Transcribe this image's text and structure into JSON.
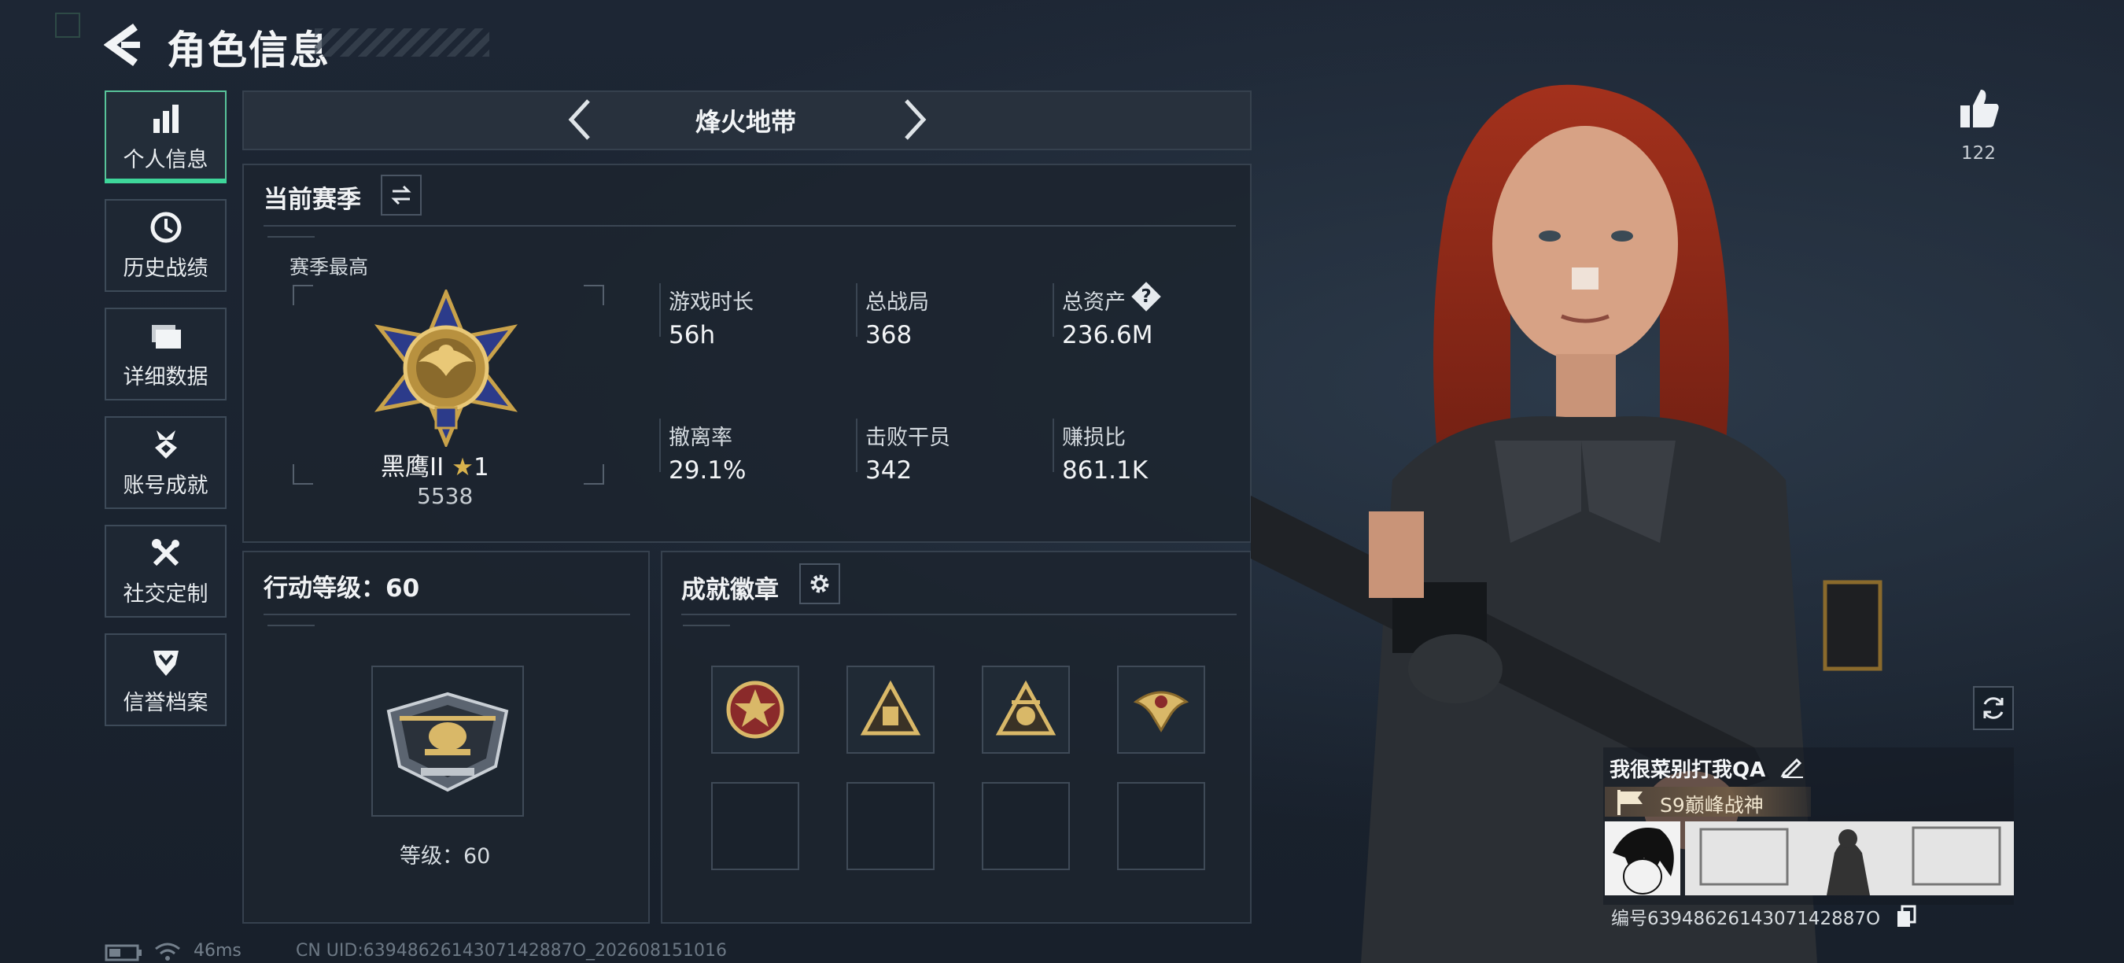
{
  "header": {
    "title": "角色信息"
  },
  "nav": {
    "items": [
      {
        "label": "个人信息",
        "icon": "bar-chart-icon",
        "active": true
      },
      {
        "label": "历史战绩",
        "icon": "clock-icon",
        "active": false
      },
      {
        "label": "详细数据",
        "icon": "folder-icon",
        "active": false
      },
      {
        "label": "账号成就",
        "icon": "medal-icon",
        "active": false
      },
      {
        "label": "社交定制",
        "icon": "wrench-icon",
        "active": false
      },
      {
        "label": "信誉档案",
        "icon": "shield-icon",
        "active": false
      }
    ]
  },
  "mode": {
    "title": "烽火地带"
  },
  "season": {
    "title": "当前赛季",
    "highest_label": "赛季最高",
    "rank_name": "黑鹰II",
    "rank_stars": "1",
    "rank_points": "5538",
    "stats": [
      {
        "label": "游戏时长",
        "value": "56h"
      },
      {
        "label": "总战局",
        "value": "368"
      },
      {
        "label": "总资产",
        "value": "236.6M",
        "help": "?"
      },
      {
        "label": "撤离率",
        "value": "29.1%"
      },
      {
        "label": "击败干员",
        "value": "342"
      },
      {
        "label": "赚损比",
        "value": "861.1K"
      }
    ]
  },
  "action_level": {
    "title": "行动等级：60",
    "level_text": "等级：60"
  },
  "badges": {
    "title": "成就徽章",
    "slots_filled": 4,
    "slots_total": 8
  },
  "profile": {
    "likes": "122",
    "player_name": "我很菜别打我QA",
    "title_tag": "S9巅峰战神",
    "player_id": "编号6394862614307142887O"
  },
  "status": {
    "ping": "46ms",
    "uid": "CN UID:6394862614307142887O_202608151016"
  },
  "colors": {
    "accent_green": "#3ed69a",
    "panel_border": "#36414e",
    "gold": "#c9a24a"
  }
}
